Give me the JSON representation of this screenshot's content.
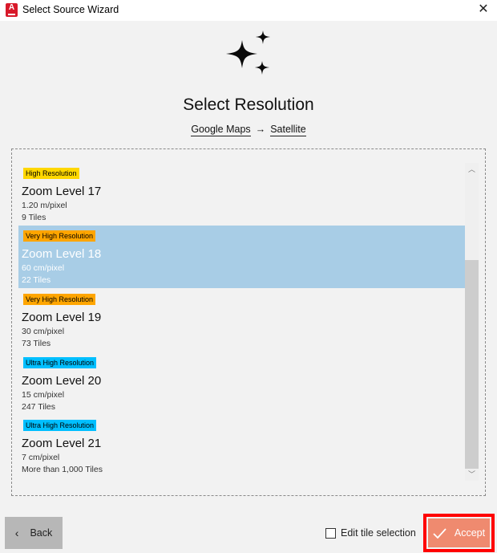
{
  "window": {
    "title": "Select Source Wizard",
    "app_icon_letter": "A"
  },
  "header": {
    "icon": "sparkles-icon",
    "title": "Select Resolution",
    "breadcrumb": {
      "source": "Google Maps",
      "arrow": "→",
      "type": "Satellite"
    }
  },
  "list": {
    "items": [
      {
        "badge": "High Resolution",
        "badge_color": "#ffd700",
        "title": "Zoom Level 17",
        "resolution": "1.20 m/pixel",
        "tiles": "9 Tiles",
        "selected": false
      },
      {
        "badge": "Very High Resolution",
        "badge_color": "#ffa500",
        "title": "Zoom Level 18",
        "resolution": "60 cm/pixel",
        "tiles": "22 Tiles",
        "selected": true
      },
      {
        "badge": "Very High Resolution",
        "badge_color": "#ffa500",
        "title": "Zoom Level 19",
        "resolution": "30 cm/pixel",
        "tiles": "73 Tiles",
        "selected": false
      },
      {
        "badge": "Ultra High Resolution",
        "badge_color": "#00bfff",
        "title": "Zoom Level 20",
        "resolution": "15 cm/pixel",
        "tiles": "247 Tiles",
        "selected": false
      },
      {
        "badge": "Ultra High Resolution",
        "badge_color": "#00bfff",
        "title": "Zoom Level 21",
        "resolution": "7 cm/pixel",
        "tiles": "More than 1,000 Tiles",
        "selected": false
      }
    ]
  },
  "footer": {
    "back_label": "Back",
    "edit_tile_label": "Edit tile selection",
    "edit_tile_checked": false,
    "accept_label": "Accept"
  },
  "colors": {
    "selected_row": "#a8cde6",
    "accept_button": "#ef8a6f",
    "highlight_border": "#ff0000"
  }
}
